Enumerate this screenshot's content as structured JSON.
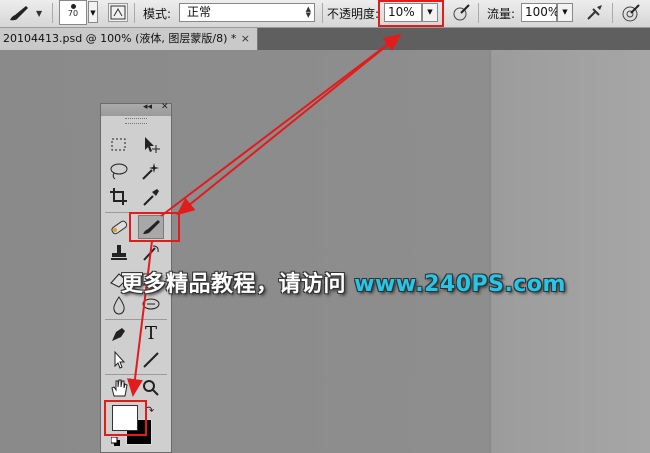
{
  "options_bar": {
    "brush_size": "70",
    "mode_label": "模式:",
    "mode_value": "正常",
    "opacity_label": "不透明度:",
    "opacity_value": "10%",
    "flow_label": "流量:",
    "flow_value": "100%"
  },
  "document_tab": {
    "title": "20104413.psd @ 100% (液体, 图层蒙版/8) *",
    "close": "×"
  },
  "tool_panel": {
    "collapse": "◂◂",
    "close": "✕",
    "type_tool_glyph": "T",
    "tools": [
      "rectangular-marquee",
      "move",
      "lasso",
      "magic-wand",
      "crop",
      "eyedropper",
      "spot-healing-brush",
      "brush",
      "clone-stamp",
      "history-brush",
      "eraser",
      "gradient",
      "blur",
      "dodge",
      "pen",
      "type",
      "path-selection",
      "line",
      "hand",
      "zoom"
    ],
    "selected_tool": "brush",
    "foreground_color": "#ffffff",
    "background_color": "#000000"
  },
  "watermark": {
    "text": "更多精品教程，请访问 ",
    "url": "www.240PS.com"
  },
  "colors": {
    "annotation_red": "#e21c1c",
    "watermark_url": "#25c6e8"
  }
}
